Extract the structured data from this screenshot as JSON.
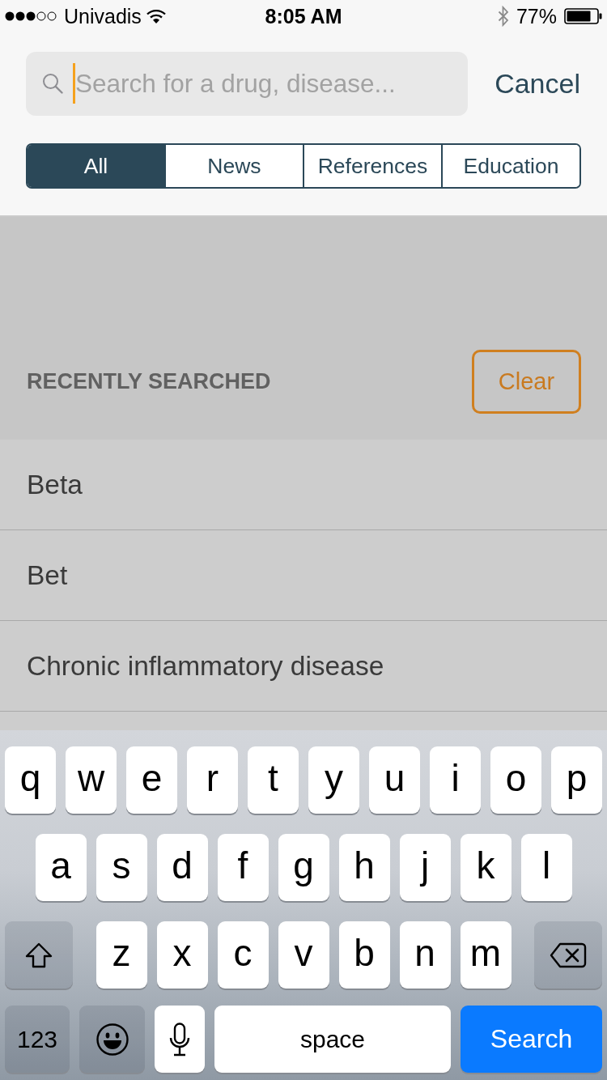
{
  "status_bar": {
    "carrier": "Univadis",
    "time": "8:05 AM",
    "battery": "77%"
  },
  "search": {
    "placeholder": "Search for a drug, disease...",
    "focused": true,
    "cancel": "Cancel"
  },
  "filter_tabs": [
    {
      "label": "All",
      "selected": true
    },
    {
      "label": "News",
      "selected": false
    },
    {
      "label": "References",
      "selected": false
    },
    {
      "label": "Education",
      "selected": false
    }
  ],
  "recently_searched": {
    "heading": "RECENTLY SEARCHED",
    "clear": "Clear",
    "items": [
      "Beta",
      "Bet",
      "Chronic inflammatory disease"
    ]
  },
  "keyboard": {
    "key_rows": [
      {
        "keys": [
          {
            "kind": "letter",
            "label": "q"
          },
          {
            "kind": "letter",
            "label": "w"
          },
          {
            "kind": "letter",
            "label": "e"
          },
          {
            "kind": "letter",
            "label": "r"
          },
          {
            "kind": "letter",
            "label": "t"
          },
          {
            "kind": "letter",
            "label": "y"
          },
          {
            "kind": "letter",
            "label": "u"
          },
          {
            "kind": "letter",
            "label": "i"
          },
          {
            "kind": "letter",
            "label": "o"
          },
          {
            "kind": "letter",
            "label": "p"
          }
        ]
      },
      {
        "keys": [
          {
            "kind": "letter",
            "label": "a"
          },
          {
            "kind": "letter",
            "label": "s"
          },
          {
            "kind": "letter",
            "label": "d"
          },
          {
            "kind": "letter",
            "label": "f"
          },
          {
            "kind": "letter",
            "label": "g"
          },
          {
            "kind": "letter",
            "label": "h"
          },
          {
            "kind": "letter",
            "label": "j"
          },
          {
            "kind": "letter",
            "label": "k"
          },
          {
            "kind": "letter",
            "label": "l"
          }
        ]
      },
      {
        "keys": [
          {
            "kind": "shift"
          },
          {
            "kind": "letter",
            "label": "z"
          },
          {
            "kind": "letter",
            "label": "x"
          },
          {
            "kind": "letter",
            "label": "c"
          },
          {
            "kind": "letter",
            "label": "v"
          },
          {
            "kind": "letter",
            "label": "b"
          },
          {
            "kind": "letter",
            "label": "n"
          },
          {
            "kind": "letter",
            "label": "m"
          },
          {
            "kind": "delete"
          }
        ]
      },
      {
        "keys": [
          {
            "kind": "numbers",
            "label": "123"
          },
          {
            "kind": "emoji"
          },
          {
            "kind": "dictation"
          },
          {
            "kind": "space",
            "label": "space"
          },
          {
            "kind": "return",
            "label": "Search"
          }
        ]
      }
    ]
  }
}
